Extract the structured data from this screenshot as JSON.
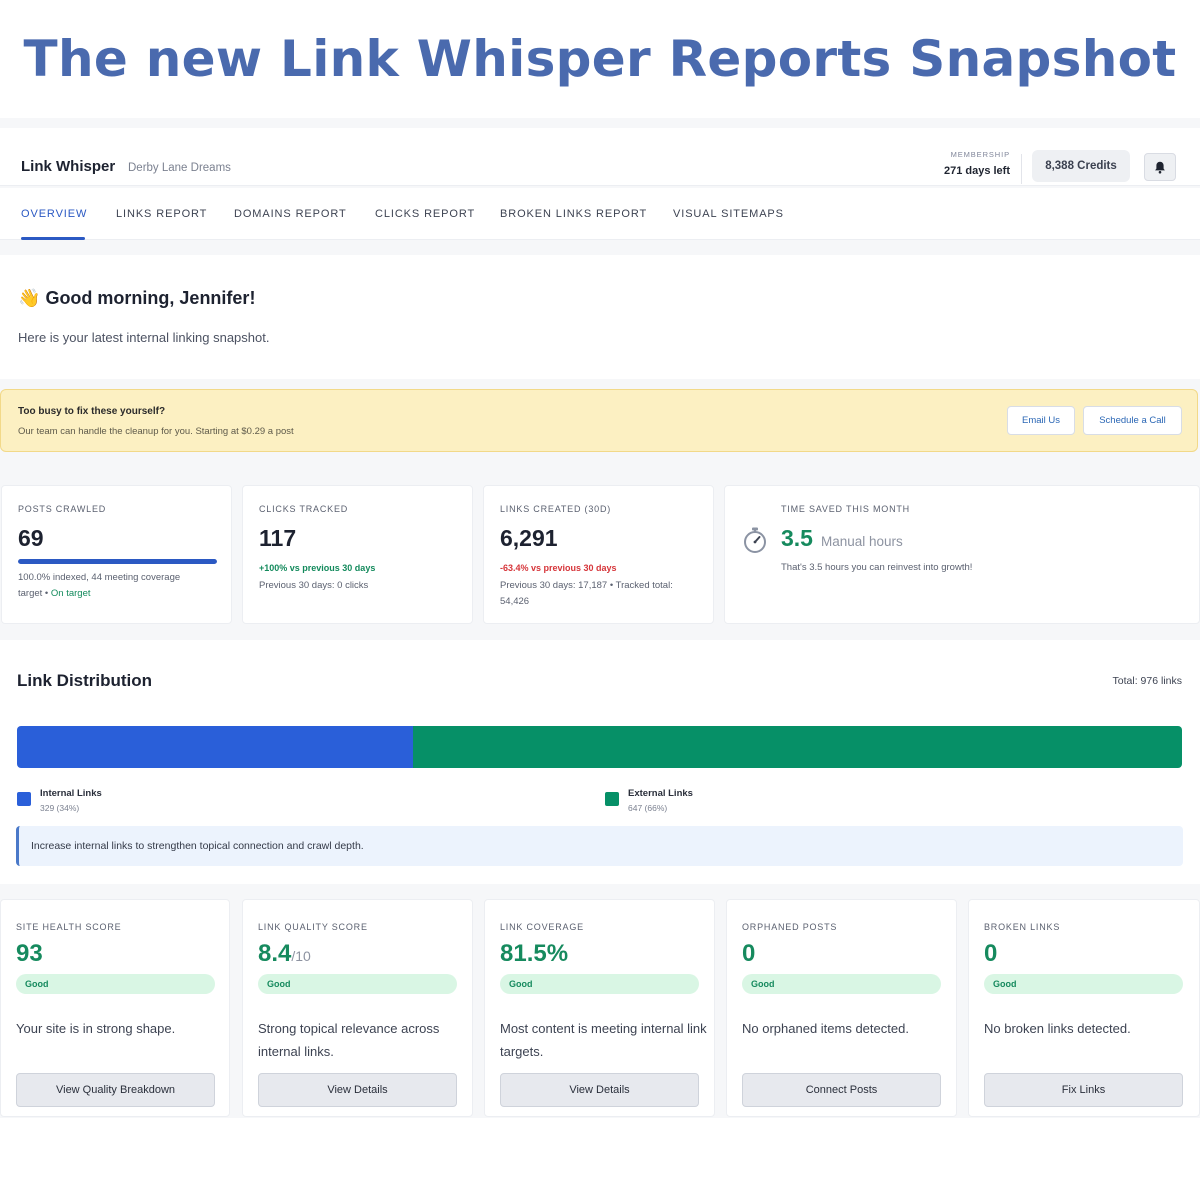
{
  "banner": {
    "title": "The new Link Whisper Reports Snapshot"
  },
  "header": {
    "brand": "Link Whisper",
    "site": "Derby Lane Dreams",
    "membership_label": "MEMBERSHIP",
    "membership_value": "271 days left",
    "credits": "8,388 Credits",
    "bell_icon": "bell-icon"
  },
  "tabs": [
    {
      "label": "OVERVIEW",
      "active": true
    },
    {
      "label": "LINKS REPORT"
    },
    {
      "label": "DOMAINS REPORT"
    },
    {
      "label": "CLICKS REPORT"
    },
    {
      "label": "BROKEN LINKS REPORT"
    },
    {
      "label": "VISUAL SITEMAPS"
    }
  ],
  "greeting": {
    "emoji": "👋",
    "title": "Good morning, Jennifer!",
    "subtitle": "Here is your latest internal linking snapshot."
  },
  "promo": {
    "title": "Too busy to fix these yourself?",
    "subtitle": "Our team can handle the cleanup for you. Starting at $0.29 a post",
    "email_button": "Email Us",
    "schedule_button": "Schedule a Call"
  },
  "stats": {
    "posts": {
      "label": "POSTS CRAWLED",
      "value": "69",
      "progress": 1.0,
      "line1": "100.0% indexed, 44 meeting coverage",
      "line2_prefix": "target •",
      "line2_status": "On target"
    },
    "clicks": {
      "label": "CLICKS TRACKED",
      "value": "117",
      "change": "+100% vs previous 30 days",
      "previous": "Previous 30 days: 0 clicks"
    },
    "links": {
      "label": "LINKS CREATED (30D)",
      "value": "6,291",
      "change": "-63.4% vs previous 30 days",
      "previous": "Previous 30 days: 17,187 • Tracked total:",
      "total": "54,426"
    },
    "time": {
      "label": "TIME SAVED THIS MONTH",
      "value": "3.5",
      "unit": "Manual hours",
      "note": "That's 3.5 hours you can reinvest into growth!",
      "icon": "stopwatch-icon"
    }
  },
  "distribution": {
    "title": "Link Distribution",
    "total": "Total: 976 links",
    "internal": {
      "name": "Internal Links",
      "value": "329 (34%)",
      "fraction": 0.34,
      "color": "#2a5fd9"
    },
    "external": {
      "name": "External Links",
      "value": "647 (66%)",
      "fraction": 0.66,
      "color": "#069067"
    },
    "tip": "Increase internal links to strengthen topical connection and crawl depth."
  },
  "scores": [
    {
      "label": "SITE HEALTH SCORE",
      "value": "93",
      "denom": "",
      "badge": "Good",
      "desc": "Your site is in strong shape.",
      "button": "View Quality Breakdown"
    },
    {
      "label": "LINK QUALITY SCORE",
      "value": "8.4",
      "denom": "/10",
      "badge": "Good",
      "desc": "Strong topical relevance across internal links.",
      "button": "View Details"
    },
    {
      "label": "LINK COVERAGE",
      "value": "81.5%",
      "denom": "",
      "badge": "Good",
      "desc": "Most content is meeting internal link targets.",
      "button": "View Details"
    },
    {
      "label": "ORPHANED POSTS",
      "value": "0",
      "denom": "",
      "badge": "Good",
      "desc": "No orphaned items detected.",
      "button": "Connect Posts"
    },
    {
      "label": "BROKEN LINKS",
      "value": "0",
      "denom": "",
      "badge": "Good",
      "desc": "No broken links detected.",
      "button": "Fix Links"
    }
  ]
}
